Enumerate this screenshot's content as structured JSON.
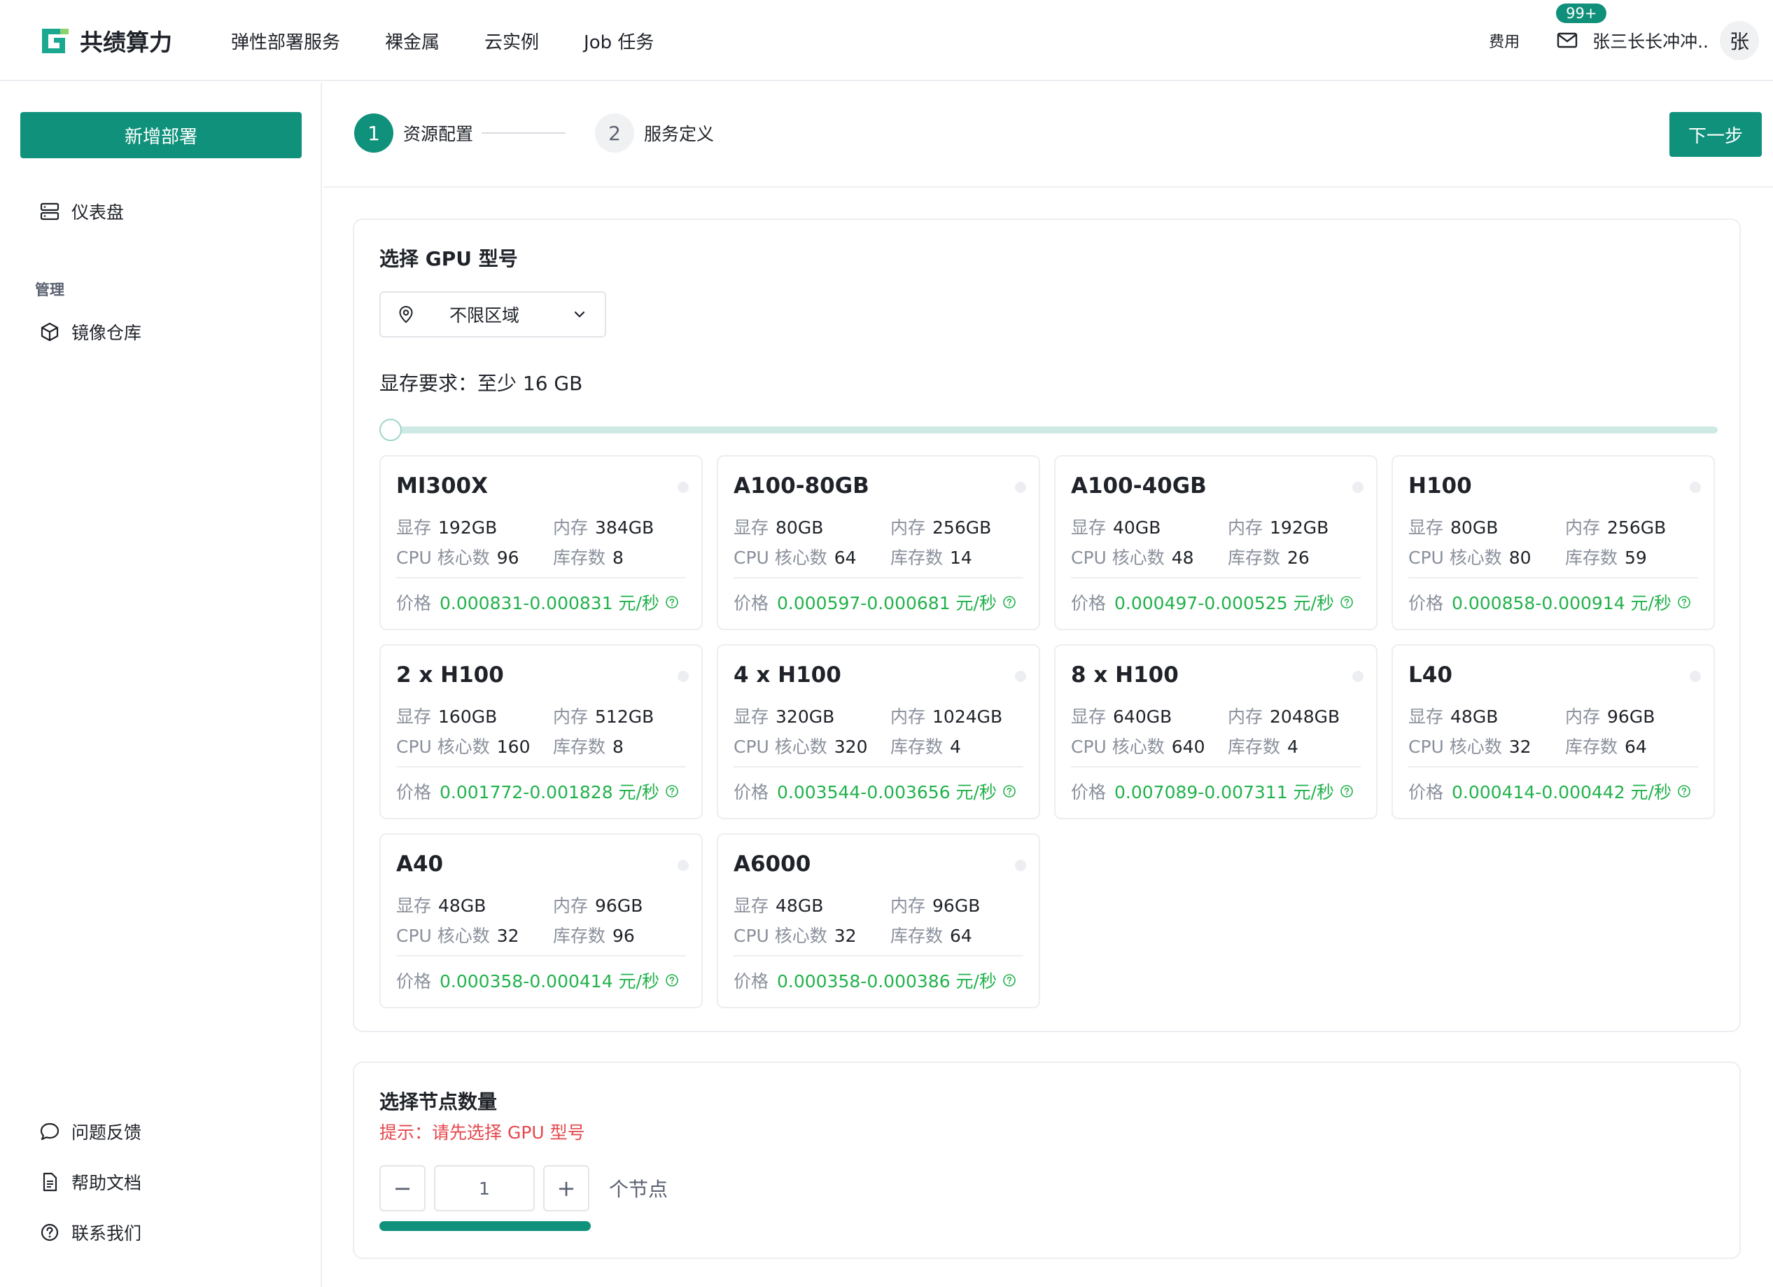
{
  "header": {
    "brand": "共绩算力",
    "nav": [
      "弹性部署服务",
      "裸金属",
      "云实例",
      "Job 任务"
    ],
    "fee": "费用",
    "mail_badge": "99+",
    "username": "张三长长冲冲..",
    "avatar": "张"
  },
  "sidebar": {
    "new_button": "新增部署",
    "dashboard": "仪表盘",
    "group_label": "管理",
    "image_repo": "镜像仓库",
    "feedback": "问题反馈",
    "help_docs": "帮助文档",
    "contact": "联系我们"
  },
  "steps": {
    "step1_num": "1",
    "step1_label": "资源配置",
    "step2_num": "2",
    "step2_label": "服务定义",
    "next_button": "下一步"
  },
  "gpu_section": {
    "title": "选择 GPU 型号",
    "region": "不限区域",
    "mem_requirement": "显存要求：至少 16 GB",
    "slider_value": 0
  },
  "labels": {
    "vram": "显存",
    "ram": "内存",
    "cpu": "CPU 核心数",
    "stock": "库存数",
    "price": "价格"
  },
  "gpus": [
    {
      "name": "MI300X",
      "vram": "192GB",
      "ram": "384GB",
      "cpu": "96",
      "stock": "8",
      "price": "0.000831-0.000831 元/秒"
    },
    {
      "name": "A100-80GB",
      "vram": "80GB",
      "ram": "256GB",
      "cpu": "64",
      "stock": "14",
      "price": "0.000597-0.000681 元/秒"
    },
    {
      "name": "A100-40GB",
      "vram": "40GB",
      "ram": "192GB",
      "cpu": "48",
      "stock": "26",
      "price": "0.000497-0.000525 元/秒"
    },
    {
      "name": "H100",
      "vram": "80GB",
      "ram": "256GB",
      "cpu": "80",
      "stock": "59",
      "price": "0.000858-0.000914 元/秒"
    },
    {
      "name": "2 x H100",
      "vram": "160GB",
      "ram": "512GB",
      "cpu": "160",
      "stock": "8",
      "price": "0.001772-0.001828 元/秒"
    },
    {
      "name": "4 x H100",
      "vram": "320GB",
      "ram": "1024GB",
      "cpu": "320",
      "stock": "4",
      "price": "0.003544-0.003656 元/秒"
    },
    {
      "name": "8 x H100",
      "vram": "640GB",
      "ram": "2048GB",
      "cpu": "640",
      "stock": "4",
      "price": "0.007089-0.007311 元/秒"
    },
    {
      "name": "L40",
      "vram": "48GB",
      "ram": "96GB",
      "cpu": "32",
      "stock": "64",
      "price": "0.000414-0.000442 元/秒"
    },
    {
      "name": "A40",
      "vram": "48GB",
      "ram": "96GB",
      "cpu": "32",
      "stock": "96",
      "price": "0.000358-0.000414 元/秒"
    },
    {
      "name": "A6000",
      "vram": "48GB",
      "ram": "96GB",
      "cpu": "32",
      "stock": "64",
      "price": "0.000358-0.000386 元/秒"
    }
  ],
  "node_section": {
    "title": "选择节点数量",
    "hint": "提示：请先选择 GPU 型号",
    "minus": "−",
    "value": "1",
    "plus": "+",
    "unit": "个节点"
  },
  "colors": {
    "primary": "#0f917b",
    "price_green": "#22b24c",
    "hint_red": "#e5484d"
  }
}
